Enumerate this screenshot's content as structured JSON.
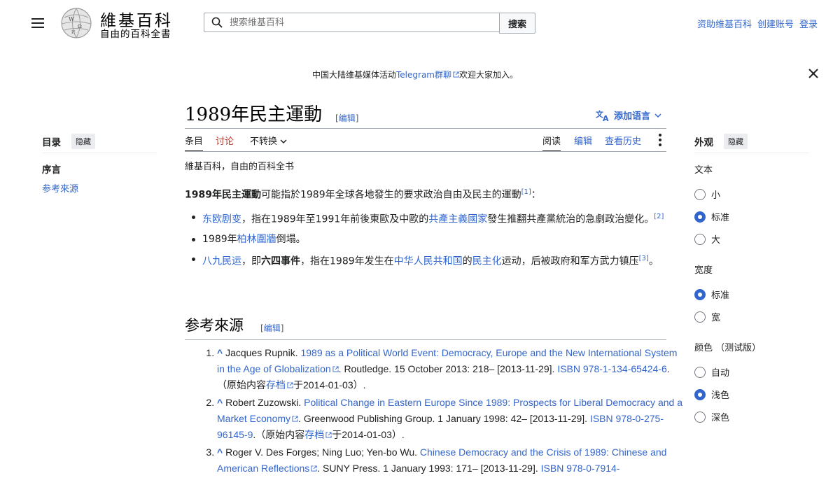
{
  "header": {
    "wordmark": "維基百科",
    "tagline": "自由的百科全書",
    "search_placeholder": "搜索维基百科",
    "search_button": "搜索",
    "user_links": [
      "资助维基百科",
      "创建账号",
      "登录"
    ]
  },
  "notice": {
    "prefix": "中国大陆维基媒体活动",
    "link": "Telegram群聊",
    "suffix": "欢迎大家加入。"
  },
  "toc": {
    "title": "目录",
    "hide": "隐藏",
    "items": [
      "序言",
      "参考來源"
    ]
  },
  "article": {
    "title": "1989年民主運動",
    "edit": "编辑",
    "add_languages": "添加语言",
    "tabs": {
      "article": "条目",
      "talk": "讨论",
      "variant": "不转换",
      "read": "阅读",
      "edit": "编辑",
      "history": "查看历史"
    },
    "site_sub": "維基百科，自由的百科全书",
    "lead": {
      "bold": "1989年民主運動",
      "text": "可能指於1989年全球各地發生的要求政治自由及民主的運動",
      "ref": "[1]",
      "end": "："
    },
    "bullets": [
      {
        "link1": "东欧剧变",
        "text1": "，指在1989年至1991年前後東歐及中歐的",
        "link2": "共產主義國家",
        "text2": "發生推翻共產黨統治的急劇政治變化。",
        "ref": "[2]"
      },
      {
        "text1": "1989年",
        "link1": "柏林圍牆",
        "text2": "倒塌。"
      },
      {
        "link1": "八九民运",
        "text1": "，即",
        "bold": "六四事件",
        "text2": "，指在1989年发生在",
        "link2": "中华人民共和国",
        "text3": "的",
        "link3": "民主化",
        "text4": "运动，后被政府和军方武力镇压",
        "ref": "[3]",
        "end": "。"
      }
    ],
    "references_heading": "参考來源",
    "references": [
      {
        "author": "Jacques Rupnik. ",
        "title": "1989 as a Political World Event: Democracy, Europe and the New International System in the Age of Globalization",
        "pub": ". Routledge. 15 October 2013: 218– [2013-11-29]. ",
        "isbn": "ISBN 978-1-134-65424-6",
        "archive_pre": ".（原始内容",
        "archive": "存档",
        "archive_post": "于2014-01-03）."
      },
      {
        "author": "Robert Zuzowski. ",
        "title": "Political Change in Eastern Europe Since 1989: Prospects for Liberal Democracy and a Market Economy",
        "pub": ". Greenwood Publishing Group. 1 January 1998: 42– [2013-11-29]. ",
        "isbn": "ISBN 978-0-275-96145-9",
        "archive_pre": ".（原始内容",
        "archive": "存档",
        "archive_post": "于2014-01-03）."
      },
      {
        "author": "Roger V. Des Forges; Ning Luo; Yen-bo Wu. ",
        "title": "Chinese Democracy and the Crisis of 1989: Chinese and American Reflections",
        "pub": ". SUNY Press. 1 January 1993: 171– [2013-11-29]. ",
        "isbn": "ISBN 978-0-7914-"
      }
    ]
  },
  "appearance": {
    "title": "外观",
    "hide": "隐藏",
    "text_label": "文本",
    "text_options": [
      "小",
      "标准",
      "大"
    ],
    "text_selected": "标准",
    "width_label": "宽度",
    "width_options": [
      "标准",
      "宽"
    ],
    "width_selected": "标准",
    "color_label": "颜色 （测试版）",
    "color_options": [
      "自动",
      "浅色",
      "深色"
    ],
    "color_selected": "浅色"
  },
  "colors": {
    "link": "#3366cc",
    "talk_red": "#bf3c2c",
    "text": "#202122"
  }
}
